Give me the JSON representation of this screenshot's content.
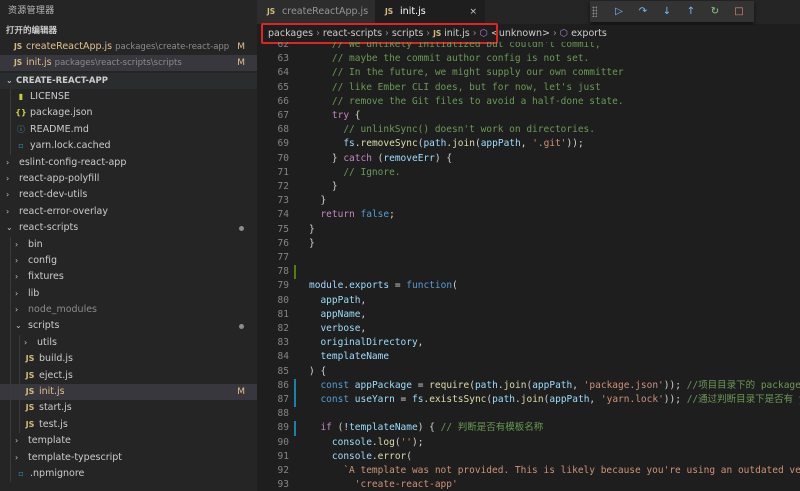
{
  "explorer": {
    "title": "资源管理器",
    "open_editors_label": "打开的编辑器",
    "open_editors": [
      {
        "icon": "JS",
        "name": "createReactApp.js",
        "path": "packages\\create-react-app",
        "status": "M"
      },
      {
        "icon": "JS",
        "name": "init.js",
        "path": "packages\\react-scripts\\scripts",
        "status": "M"
      }
    ],
    "project_label": "CREATE-REACT-APP",
    "tree": [
      {
        "label": "LICENSE",
        "icon": "license-icon",
        "glyph": "▮",
        "indent": 1
      },
      {
        "label": "package.json",
        "icon": "json-icon",
        "glyph": "{}",
        "indent": 1
      },
      {
        "label": "README.md",
        "icon": "info-icon",
        "glyph": "ⓘ",
        "indent": 1
      },
      {
        "label": "yarn.lock.cached",
        "icon": "file-icon",
        "glyph": "▫",
        "indent": 1
      },
      {
        "label": "eslint-config-react-app",
        "icon": "chevron-right-icon",
        "glyph": "›",
        "indent": 0
      },
      {
        "label": "react-app-polyfill",
        "icon": "chevron-right-icon",
        "glyph": "›",
        "indent": 0
      },
      {
        "label": "react-dev-utils",
        "icon": "chevron-right-icon",
        "glyph": "›",
        "indent": 0
      },
      {
        "label": "react-error-overlay",
        "icon": "chevron-right-icon",
        "glyph": "›",
        "indent": 0
      },
      {
        "label": "react-scripts",
        "icon": "chevron-down-icon",
        "glyph": "⌄",
        "indent": 0,
        "dot": true
      },
      {
        "label": "bin",
        "icon": "chevron-right-icon",
        "glyph": "›",
        "indent": 1
      },
      {
        "label": "config",
        "icon": "chevron-right-icon",
        "glyph": "›",
        "indent": 1
      },
      {
        "label": "fixtures",
        "icon": "chevron-right-icon",
        "glyph": "›",
        "indent": 1
      },
      {
        "label": "lib",
        "icon": "chevron-right-icon",
        "glyph": "›",
        "indent": 1
      },
      {
        "label": "node_modules",
        "icon": "chevron-right-icon",
        "glyph": "›",
        "indent": 1,
        "dim": true
      },
      {
        "label": "scripts",
        "icon": "chevron-down-icon",
        "glyph": "⌄",
        "indent": 1,
        "dot": true
      },
      {
        "label": "utils",
        "icon": "chevron-right-icon",
        "glyph": "›",
        "indent": 2
      },
      {
        "label": "build.js",
        "icon": "js-icon",
        "glyph": "JS",
        "indent": 2
      },
      {
        "label": "eject.js",
        "icon": "js-icon",
        "glyph": "JS",
        "indent": 2
      },
      {
        "label": "init.js",
        "icon": "js-icon",
        "glyph": "JS",
        "indent": 2,
        "status": "M",
        "active": true
      },
      {
        "label": "start.js",
        "icon": "js-icon",
        "glyph": "JS",
        "indent": 2
      },
      {
        "label": "test.js",
        "icon": "js-icon",
        "glyph": "JS",
        "indent": 2
      },
      {
        "label": "template",
        "icon": "chevron-right-icon",
        "glyph": "›",
        "indent": 1
      },
      {
        "label": "template-typescript",
        "icon": "chevron-right-icon",
        "glyph": "›",
        "indent": 1
      },
      {
        "label": ".npmignore",
        "icon": "file-icon",
        "glyph": "▫",
        "indent": 1
      }
    ]
  },
  "tabs": [
    {
      "icon": "JS",
      "label": "createReactApp.js"
    },
    {
      "icon": "JS",
      "label": "init.js",
      "close": "×"
    }
  ],
  "debug_toolbar": [
    {
      "name": "continue-icon",
      "glyph": "▷",
      "color": "#75beff"
    },
    {
      "name": "step-over-icon",
      "glyph": "↷",
      "color": "#75beff"
    },
    {
      "name": "step-into-icon",
      "glyph": "↓",
      "color": "#75beff"
    },
    {
      "name": "step-out-icon",
      "glyph": "↑",
      "color": "#75beff"
    },
    {
      "name": "restart-icon",
      "glyph": "↻",
      "color": "#89d185"
    },
    {
      "name": "stop-icon",
      "glyph": "□",
      "color": "#f48771"
    }
  ],
  "breadcrumb": [
    "packages",
    "react-scripts",
    "scripts",
    "init.js",
    "<unknown>",
    "exports"
  ],
  "colors": {
    "accent": "#007acc",
    "modified": "#e2c08d",
    "highlight_box": "#e02424",
    "gutter_added": "#587c0c",
    "gutter_modified": "#1b81a8"
  },
  "code_lines": [
    {
      "n": "62",
      "gutter": "",
      "tokens": [
        [
          "cm",
          "    // We unlikely initialized but couldn't commit,"
        ]
      ]
    },
    {
      "n": "63",
      "gutter": "",
      "tokens": [
        [
          "cm",
          "    // maybe the commit author config is not set."
        ]
      ]
    },
    {
      "n": "64",
      "gutter": "",
      "tokens": [
        [
          "cm",
          "    // In the future, we might supply our own committer"
        ]
      ]
    },
    {
      "n": "65",
      "gutter": "",
      "tokens": [
        [
          "cm",
          "    // like Ember CLI does, but for now, let's just"
        ]
      ]
    },
    {
      "n": "66",
      "gutter": "",
      "tokens": [
        [
          "cm",
          "    // remove the Git files to avoid a half-done state."
        ]
      ]
    },
    {
      "n": "67",
      "gutter": "",
      "tokens": [
        [
          "kwc",
          "    try"
        ],
        [
          "op",
          " {"
        ]
      ]
    },
    {
      "n": "68",
      "gutter": "",
      "tokens": [
        [
          "cm",
          "      // unlinkSync() doesn't work on directories."
        ]
      ]
    },
    {
      "n": "69",
      "gutter": "",
      "tokens": [
        [
          "var",
          "      fs"
        ],
        [
          "op",
          "."
        ],
        [
          "fn",
          "removeSync"
        ],
        [
          "op",
          "("
        ],
        [
          "var",
          "path"
        ],
        [
          "op",
          "."
        ],
        [
          "fn",
          "join"
        ],
        [
          "op",
          "("
        ],
        [
          "var",
          "appPath"
        ],
        [
          "op",
          ", "
        ],
        [
          "str",
          "'.git'"
        ],
        [
          "op",
          "));"
        ]
      ]
    },
    {
      "n": "70",
      "gutter": "",
      "tokens": [
        [
          "op",
          "    } "
        ],
        [
          "kwc",
          "catch"
        ],
        [
          "op",
          " ("
        ],
        [
          "var",
          "removeErr"
        ],
        [
          "op",
          ") {"
        ]
      ]
    },
    {
      "n": "71",
      "gutter": "",
      "tokens": [
        [
          "cm",
          "      // Ignore."
        ]
      ]
    },
    {
      "n": "72",
      "gutter": "",
      "tokens": [
        [
          "op",
          "    }"
        ]
      ]
    },
    {
      "n": "73",
      "gutter": "",
      "tokens": [
        [
          "op",
          "  }"
        ]
      ]
    },
    {
      "n": "74",
      "gutter": "",
      "tokens": [
        [
          "kwc",
          "  return"
        ],
        [
          "op",
          " "
        ],
        [
          "kw",
          "false"
        ],
        [
          "op",
          ";"
        ]
      ]
    },
    {
      "n": "75",
      "gutter": "",
      "tokens": [
        [
          "op",
          "}"
        ]
      ]
    },
    {
      "n": "76",
      "gutter": "",
      "tokens": [
        [
          "op",
          "}"
        ]
      ]
    },
    {
      "n": "77",
      "gutter": "",
      "tokens": []
    },
    {
      "n": "78",
      "gutter": "added",
      "tokens": []
    },
    {
      "n": "79",
      "gutter": "",
      "tokens": [
        [
          "var",
          "module"
        ],
        [
          "op",
          "."
        ],
        [
          "var",
          "exports"
        ],
        [
          "op",
          " = "
        ],
        [
          "kw",
          "function"
        ],
        [
          "op",
          "("
        ]
      ]
    },
    {
      "n": "80",
      "gutter": "",
      "tokens": [
        [
          "var",
          "  appPath"
        ],
        [
          "op",
          ","
        ]
      ]
    },
    {
      "n": "81",
      "gutter": "",
      "tokens": [
        [
          "var",
          "  appName"
        ],
        [
          "op",
          ","
        ]
      ]
    },
    {
      "n": "82",
      "gutter": "",
      "tokens": [
        [
          "var",
          "  verbose"
        ],
        [
          "op",
          ","
        ]
      ]
    },
    {
      "n": "83",
      "gutter": "",
      "tokens": [
        [
          "var",
          "  originalDirectory"
        ],
        [
          "op",
          ","
        ]
      ]
    },
    {
      "n": "84",
      "gutter": "",
      "tokens": [
        [
          "var",
          "  templateName"
        ]
      ]
    },
    {
      "n": "85",
      "gutter": "",
      "tokens": [
        [
          "op",
          ") {"
        ]
      ]
    },
    {
      "n": "86",
      "gutter": "modified",
      "tokens": [
        [
          "kw",
          "  const"
        ],
        [
          "op",
          " "
        ],
        [
          "var",
          "appPackage"
        ],
        [
          "op",
          " = "
        ],
        [
          "fn",
          "require"
        ],
        [
          "op",
          "("
        ],
        [
          "var",
          "path"
        ],
        [
          "op",
          "."
        ],
        [
          "fn",
          "join"
        ],
        [
          "op",
          "("
        ],
        [
          "var",
          "appPath"
        ],
        [
          "op",
          ", "
        ],
        [
          "str",
          "'package.json'"
        ],
        [
          "op",
          ")); "
        ],
        [
          "cm",
          "//项目目录下的 package.json"
        ]
      ]
    },
    {
      "n": "87",
      "gutter": "modified",
      "tokens": [
        [
          "kw",
          "  const"
        ],
        [
          "op",
          " "
        ],
        [
          "var",
          "useYarn"
        ],
        [
          "op",
          " = "
        ],
        [
          "var",
          "fs"
        ],
        [
          "op",
          "."
        ],
        [
          "fn",
          "existsSync"
        ],
        [
          "op",
          "("
        ],
        [
          "var",
          "path"
        ],
        [
          "op",
          "."
        ],
        [
          "fn",
          "join"
        ],
        [
          "op",
          "("
        ],
        [
          "var",
          "appPath"
        ],
        [
          "op",
          ", "
        ],
        [
          "str",
          "'yarn.lock'"
        ],
        [
          "op",
          ")); "
        ],
        [
          "cm",
          "//通过判断目录下是否有 yarn.lock"
        ]
      ]
    },
    {
      "n": "88",
      "gutter": "",
      "tokens": []
    },
    {
      "n": "89",
      "gutter": "modified",
      "tokens": [
        [
          "kwc",
          "  if"
        ],
        [
          "op",
          " (!"
        ],
        [
          "var",
          "templateName"
        ],
        [
          "op",
          ") { "
        ],
        [
          "cm",
          "// 判断是否有模板名称"
        ]
      ]
    },
    {
      "n": "90",
      "gutter": "",
      "tokens": [
        [
          "var",
          "    console"
        ],
        [
          "op",
          "."
        ],
        [
          "fn",
          "log"
        ],
        [
          "op",
          "("
        ],
        [
          "str",
          "''"
        ],
        [
          "op",
          ");"
        ]
      ]
    },
    {
      "n": "91",
      "gutter": "",
      "tokens": [
        [
          "var",
          "    console"
        ],
        [
          "op",
          "."
        ],
        [
          "fn",
          "error"
        ],
        [
          "op",
          "("
        ]
      ]
    },
    {
      "n": "92",
      "gutter": "",
      "tokens": [
        [
          "str",
          "      `A template was not provided. This is likely because you're using an outdated version"
        ]
      ]
    },
    {
      "n": "93",
      "gutter": "",
      "tokens": [
        [
          "str",
          "        'create-react-app'"
        ]
      ]
    }
  ]
}
